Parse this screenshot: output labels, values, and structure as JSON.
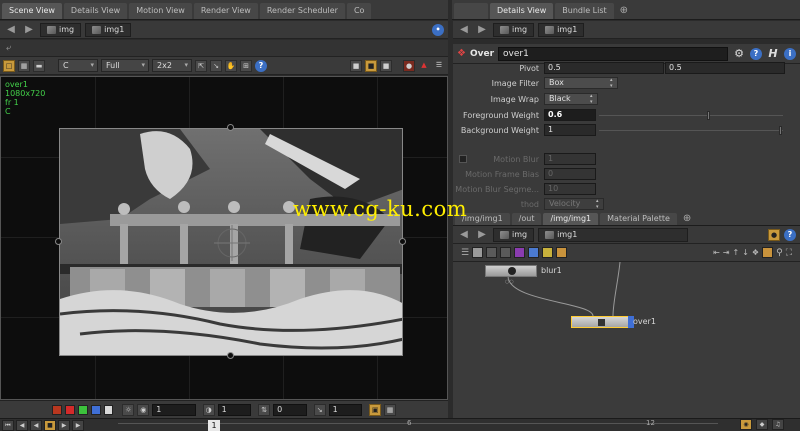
{
  "left_tabs": [
    "Scene View",
    "Details View",
    "Motion View",
    "Render View",
    "Render Scheduler",
    "Co"
  ],
  "right_tabs": [
    "Details View",
    "Bundle List"
  ],
  "tab_add_glyph": "⊕",
  "viewer_path": {
    "seg1": "img",
    "seg2": "img1"
  },
  "param_path": {
    "seg1": "img",
    "seg2": "img1"
  },
  "viewer_toolbar": {
    "channel": "C",
    "resolution": "Full",
    "scale": "2x2"
  },
  "viewer_info": {
    "node": "over1",
    "res": "1080x720",
    "frame": "fr 1",
    "plane": "C"
  },
  "viewer_bottom": {
    "field1": "1",
    "field2": "1",
    "field3": "0",
    "field4": "1"
  },
  "swatch_colors": [
    "#b8371f",
    "#d42a2a",
    "#3cc23c",
    "#3f6fd6",
    "#d9d9d9"
  ],
  "timeline": {
    "current_frame": "1",
    "tick_6": "6",
    "tick_12": "12"
  },
  "param_header": {
    "type": "Over",
    "name": "over1",
    "help": "?",
    "h_label": "H",
    "info": "i"
  },
  "params": {
    "pivot_label": "Pivot",
    "pivot_x": "0.5",
    "pivot_y": "0.5",
    "filter_label": "Image Filter",
    "filter_value": "Box",
    "wrap_label": "Image Wrap",
    "wrap_value": "Black",
    "fg_label": "Foreground Weight",
    "fg_value": "0.6",
    "fg_level": 0.6,
    "bg_label": "Background Weight",
    "bg_value": "1",
    "bg_level": 1.0,
    "mblur_label": "Motion Blur",
    "mblur_value": "1",
    "mframe_label": "Motion Frame Bias",
    "mframe_value": "0",
    "mseg_label": "Motion Blur Segme...",
    "mseg_value": "10",
    "method_label": "thod",
    "method_value": "Velocity"
  },
  "network_tabs": [
    "/img/img1",
    "/out",
    "/img/img1",
    "Material Palette"
  ],
  "network_path": {
    "seg1": "img",
    "seg2": "img1"
  },
  "nodes": {
    "blur": "blur1",
    "over": "over1"
  },
  "watermark": "www.cg-ku.com"
}
